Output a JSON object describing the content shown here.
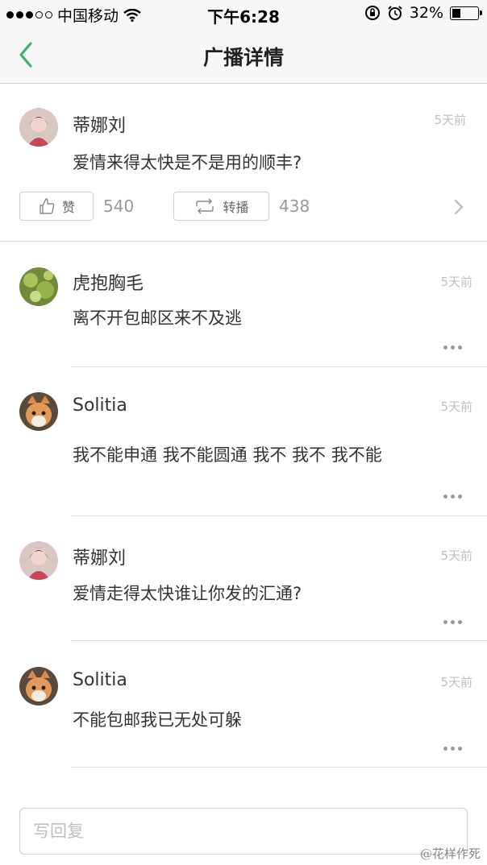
{
  "status_bar": {
    "carrier": "中国移动",
    "time": "下午6:28",
    "battery": "32%",
    "battery_level": 0.32,
    "signal_filled": 3,
    "signal_total": 5
  },
  "nav": {
    "title": "广播详情"
  },
  "post": {
    "author": "蒂娜刘",
    "time": "5天前",
    "text": "爱情来得太快是不是用的顺丰?",
    "like_label": "赞",
    "like_count": "540",
    "repost_label": "转播",
    "repost_count": "438"
  },
  "comments": [
    {
      "author": "虎抱胸毛",
      "time": "5天前",
      "text": "离不开包邮区来不及逃",
      "avatar": "plant"
    },
    {
      "author": "Solitia",
      "time": "5天前",
      "text": "我不能申通 我不能圆通 我不 我不 我不能",
      "avatar": "cat"
    },
    {
      "author": "蒂娜刘",
      "time": "5天前",
      "text": "爱情走得太快谁让你发的汇通?",
      "avatar": "girl"
    },
    {
      "author": "Solitia",
      "time": "5天前",
      "text": "不能包邮我已无处可躲",
      "avatar": "cat"
    }
  ],
  "reply": {
    "placeholder": "写回复"
  },
  "watermark": "@花样作死",
  "colors": {
    "accent": "#3cb371",
    "divider": "#e0e0e0",
    "muted": "#c0c0c0"
  }
}
